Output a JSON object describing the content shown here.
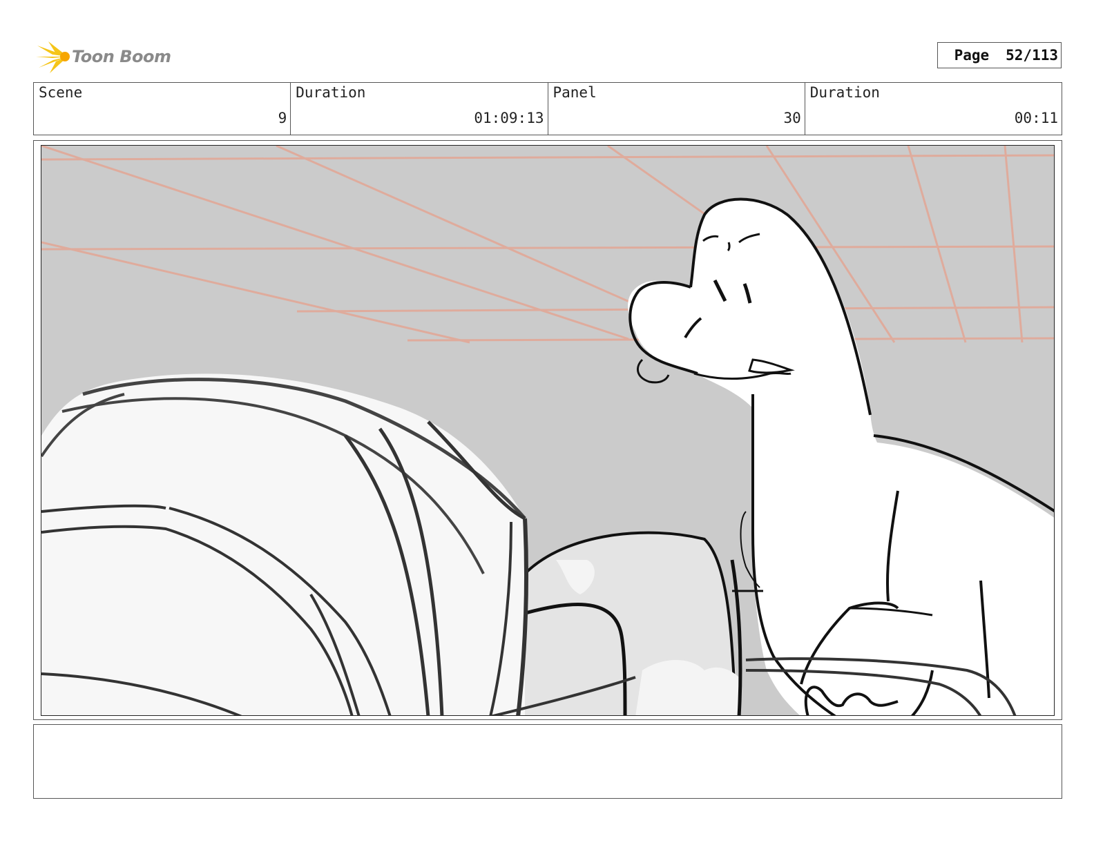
{
  "header": {
    "logo_text": "Toon Boom",
    "page_label": "Page",
    "page_value": "52/113"
  },
  "info": {
    "scene_label": "Scene",
    "scene_value": "9",
    "scene_duration_label": "Duration",
    "scene_duration_value": "01:09:13",
    "panel_label": "Panel",
    "panel_value": "30",
    "panel_duration_label": "Duration",
    "panel_duration_value": "00:11"
  },
  "notes": {
    "text": ""
  },
  "colors": {
    "background_gray": "#cbcbcb",
    "guide_lines": "#e2a898",
    "ink": "#111111",
    "logo_yellow": "#f5c518"
  }
}
